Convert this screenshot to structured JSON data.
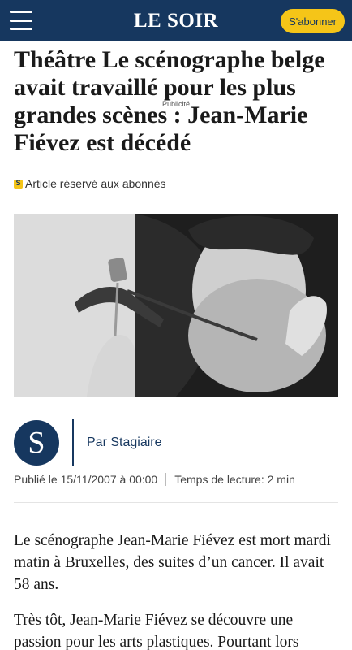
{
  "header": {
    "logo": "LE SOIR",
    "subscribe_label": "S'abonner",
    "menu_icon": "hamburger-icon"
  },
  "article": {
    "title": "Théâtre Le scénographe belge avait travaillé pour les plus grandes scènes : Jean-Marie Fiévez est décédé",
    "ad_label": "Publicité",
    "premium_label": "Article réservé aux abonnés",
    "premium_icon": "subscriber-badge-icon",
    "author_initial": "S",
    "author": "Par Stagiaire",
    "published": "Publié le 15/11/2007 à 00:00",
    "reading_time": "Temps de lecture: 2 min",
    "paragraphs": [
      "Le scénographe Jean-Marie Fiévez est mort mardi matin à Bruxelles, des suites d’un cancer. Il avait 58 ans.",
      "Très tôt, Jean-Marie Fiévez se découvre une passion pour les arts plastiques. Pourtant lors"
    ]
  },
  "colors": {
    "header_bg": "#16375f",
    "subscribe_bg": "#f5c518"
  }
}
